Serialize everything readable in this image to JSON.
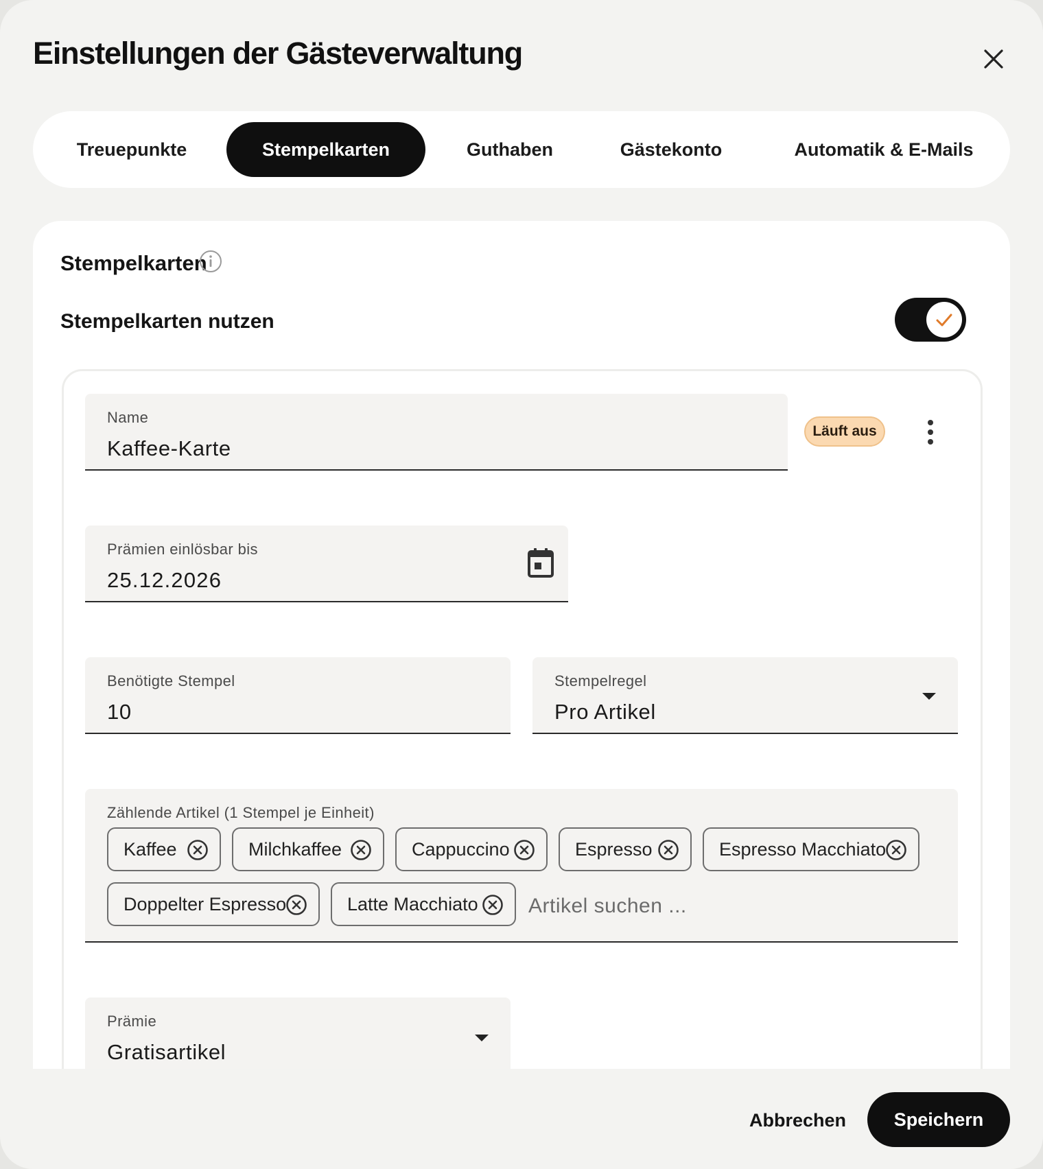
{
  "dialog": {
    "title": "Einstellungen der Gästeverwaltung"
  },
  "tabs": [
    {
      "label": "Treuepunkte",
      "active": false
    },
    {
      "label": "Stempelkarten",
      "active": true
    },
    {
      "label": "Guthaben",
      "active": false
    },
    {
      "label": "Gästekonto",
      "active": false
    },
    {
      "label": "Automatik & E-Mails",
      "active": false
    }
  ],
  "section": {
    "title": "Stempelkarten",
    "toggle_label": "Stempelkarten nutzen",
    "toggle_on": true
  },
  "card": {
    "name_label": "Name",
    "name_value": "Kaffee-Karte",
    "status_badge": "Läuft aus",
    "redeem_label": "Prämien einlösbar bis",
    "redeem_value": "25.12.2026",
    "stamps_label": "Benötigte Stempel",
    "stamps_value": "10",
    "rule_label": "Stempelregel",
    "rule_value": "Pro Artikel",
    "articles_label": "Zählende Artikel (1 Stempel je Einheit)",
    "articles": [
      "Kaffee",
      "Milchkaffee",
      "Cappuccino",
      "Espresso",
      "Espresso Macchiato",
      "Doppelter Espresso",
      "Latte Macchiato"
    ],
    "articles_placeholder": "Artikel suchen ...",
    "reward_label": "Prämie",
    "reward_value": "Gratisartikel"
  },
  "footer": {
    "cancel_label": "Abbrechen",
    "save_label": "Speichern"
  },
  "colors": {
    "accent": "#0f0f0f",
    "badge_bg": "#fbd9b1",
    "check": "#e07b2a"
  }
}
